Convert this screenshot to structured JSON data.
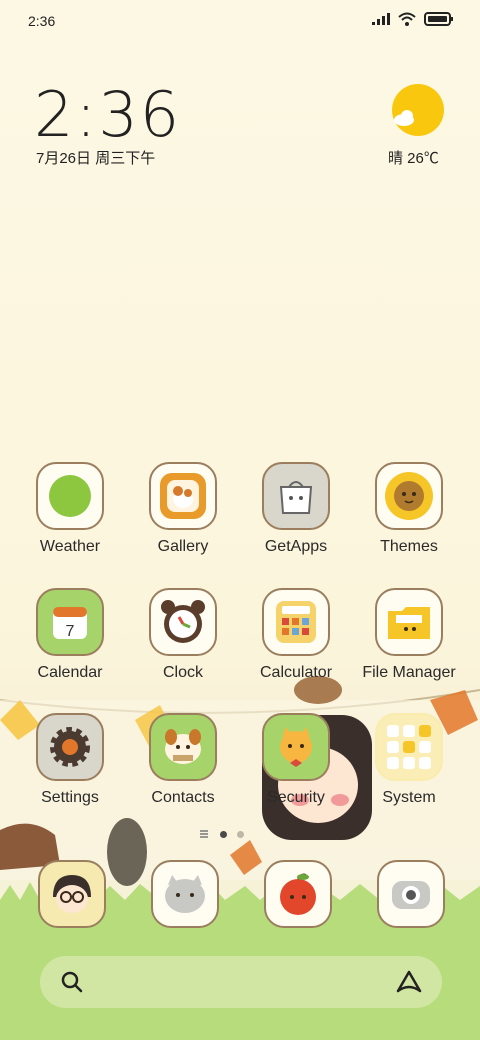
{
  "status_bar": {
    "time": "2:36"
  },
  "clock_widget": {
    "time": "2:36",
    "date": "7月26日 周三下午"
  },
  "weather_widget": {
    "condition_temp": "晴 26℃"
  },
  "apps": [
    {
      "name": "Weather"
    },
    {
      "name": "Gallery"
    },
    {
      "name": "GetApps"
    },
    {
      "name": "Themes"
    },
    {
      "name": "Calendar",
      "calendar_day": "7"
    },
    {
      "name": "Clock"
    },
    {
      "name": "Calculator"
    },
    {
      "name": "File Manager"
    },
    {
      "name": "Settings"
    },
    {
      "name": "Contacts"
    },
    {
      "name": "Security"
    },
    {
      "name": "System"
    }
  ],
  "page_indicator": {
    "pages": 2,
    "current": 1
  },
  "dock": [
    "phone",
    "messages",
    "browser",
    "camera"
  ],
  "colors": {
    "accent_green": "#8dc63f",
    "icon_border": "#9b7e5e",
    "sun": "#f9c80e"
  }
}
